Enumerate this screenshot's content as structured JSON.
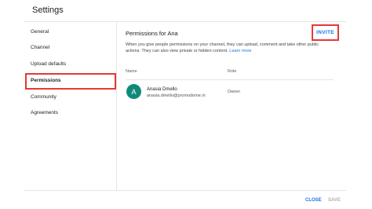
{
  "header": {
    "title": "Settings"
  },
  "sidebar": {
    "items": [
      {
        "label": "General"
      },
      {
        "label": "Channel"
      },
      {
        "label": "Upload defaults"
      },
      {
        "label": "Permissions"
      },
      {
        "label": "Community"
      },
      {
        "label": "Agreements"
      }
    ],
    "active": "Permissions"
  },
  "main": {
    "title": "Permissions for Ana",
    "invite_label": "INVITE",
    "description": "When you give people permissions on your channel, they can upload, comment and take other public actions. They can also view private or hidden content.",
    "learn_more": "Learn more",
    "columns": {
      "name": "Name",
      "role": "Role"
    },
    "users": [
      {
        "initial": "A",
        "name": "Anasia Dmello",
        "email": "anasia.dmello@promodome.in",
        "role": "Owner"
      }
    ]
  },
  "footer": {
    "close_label": "CLOSE",
    "save_label": "SAVE"
  },
  "colors": {
    "accent": "#1a73e8",
    "highlight": "#e53935",
    "avatar": "#0f8a7a"
  }
}
